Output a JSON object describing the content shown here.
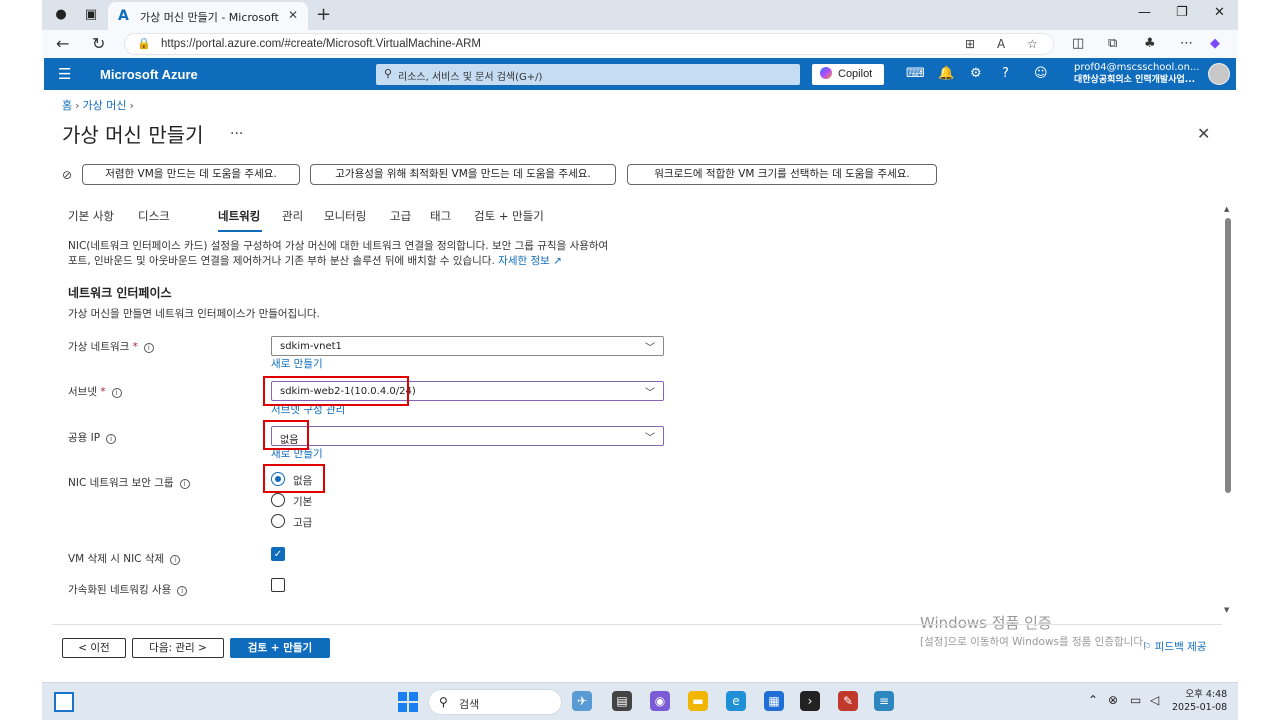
{
  "browser": {
    "tab_title": "가상 머신 만들기 - Microsoft Azure",
    "url": "https://portal.azure.com/#create/Microsoft.VirtualMachine-ARM"
  },
  "azure": {
    "brand": "Microsoft Azure",
    "search_placeholder": "리소스, 서비스 및 문서 검색(G+/)",
    "copilot_label": "Copilot",
    "account_email": "prof04@mscsschool.on...",
    "account_org": "대한상공회의소 인력개발사업..."
  },
  "breadcrumb": [
    "홈",
    "가상 머신"
  ],
  "page": {
    "title": "가상 머신 만들기",
    "more": "..."
  },
  "assist_pills": [
    "저렴한 VM을 만드는 데 도움을 주세요.",
    "고가용성을 위해 최적화된 VM을 만드는 데 도움을 주세요.",
    "워크로드에 적합한 VM 크기를 선택하는 데 도움을 주세요."
  ],
  "tabs": [
    "기본 사항",
    "디스크",
    "네트워킹",
    "관리",
    "모니터링",
    "고급",
    "태그",
    "검토 + 만들기"
  ],
  "active_tab": "네트워킹",
  "description": {
    "line1": "NIC(네트워크 인터페이스 카드) 설정을 구성하여 가상 머신에 대한 네트워크 연결을 정의합니다. 보안 그룹 규칙을 사용하여",
    "line2": "포트, 인바운드 및 아웃바운드 연결을 제어하거나 기존 부하 분산 솔루션 뒤에 배치할 수 있습니다.",
    "link": "자세한 정보"
  },
  "section": {
    "title": "네트워크 인터페이스",
    "desc": "가상 머신을 만들면 네트워크 인터페이스가 만들어집니다."
  },
  "fields": {
    "vnet": {
      "label": "가상 네트워크",
      "value": "sdkim-vnet1",
      "link": "새로 만들기"
    },
    "subnet": {
      "label": "서브넷",
      "value": "sdkim-web2-1(10.0.4.0/24)",
      "link": "서브넷 구성 관리"
    },
    "public_ip": {
      "label": "공용 IP",
      "value": "없음",
      "link": "새로 만들기"
    },
    "nsg": {
      "label": "NIC 네트워크 보안 그룹",
      "options": [
        "없음",
        "기본",
        "고급"
      ],
      "selected": "없음"
    },
    "delete_nic": {
      "label": "VM 삭제 시 NIC 삭제",
      "checked": true
    },
    "accel": {
      "label": "가속화된 네트워킹 사용",
      "checked": false
    }
  },
  "footer": {
    "prev": "< 이전",
    "next": "다음: 관리 >",
    "review": "검토 + 만들기",
    "feedback": "피드백 제공"
  },
  "watermark": {
    "line1": "Windows 정품 인증",
    "line2": "[설정]으로 이동하여 Windows를 정품 인증합니다."
  },
  "taskbar": {
    "search": "검색",
    "time": "오후 4:48",
    "date": "2025-01-08"
  }
}
